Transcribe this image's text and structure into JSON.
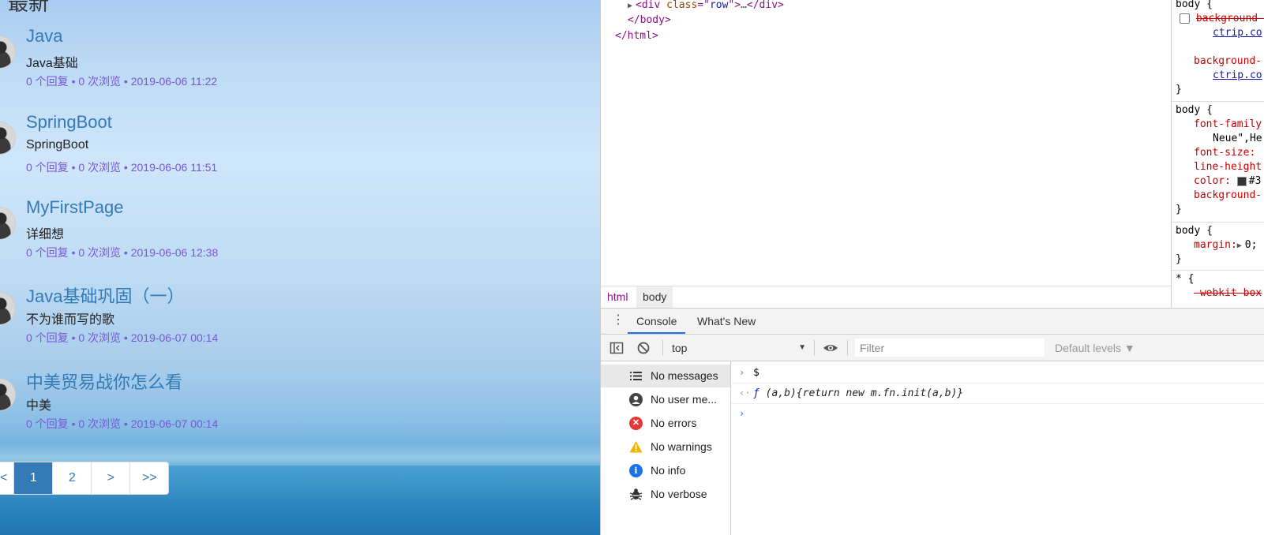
{
  "left": {
    "section_title": "最新",
    "topics": [
      {
        "title": "Java",
        "desc": "Java基础",
        "meta": "0 个回复 • 0 次浏览 • 2019-06-06 11:22"
      },
      {
        "title": "SpringBoot",
        "desc": "SpringBoot",
        "meta": "0 个回复 • 0 次浏览 • 2019-06-06 11:51"
      },
      {
        "title": "MyFirstPage",
        "desc": "详细想",
        "meta": "0 个回复 • 0 次浏览 • 2019-06-06 12:38"
      },
      {
        "title": "Java基础巩固（一）",
        "desc": "不为谁而写的歌",
        "meta": "0 个回复 • 0 次浏览 • 2019-06-07 00:14"
      },
      {
        "title": "中美贸易战你怎么看",
        "desc": "中美",
        "meta": "0 个回复 • 0 次浏览 • 2019-06-07 00:14"
      }
    ],
    "pagination": [
      "<",
      "1",
      "2",
      ">",
      ">>"
    ],
    "active_page": "1"
  },
  "devtools": {
    "elements": {
      "line1_tag_open": "<div ",
      "line1_attr": "class",
      "line1_eq": "=\"",
      "line1_val": "row",
      "line1_close": "\">",
      "line1_ellipsis": "…",
      "line1_end": "</div>",
      "line2": "</body>",
      "line3": "</html>"
    },
    "breadcrumbs": [
      "html",
      "body"
    ],
    "styles": {
      "rule1_selector": "body {",
      "rule1_prop1": "background-",
      "rule1_link1": "ctrip.co",
      "rule1_prop2": "background-",
      "rule1_link2": "ctrip.co",
      "rule2_selector": "body {",
      "rule2_props": [
        "font-family",
        "Neue\",He",
        "font-size:",
        "line-height",
        "color: ",
        "#3",
        "background-"
      ],
      "rule3_selector": "body {",
      "rule3_prop": "margin:",
      "rule3_value": "0;",
      "rule4_selector": "* {",
      "rule4_prop": "-webkit-box",
      "close_brace": "}"
    },
    "drawer_tabs": [
      "Console",
      "What's New"
    ],
    "toolbar": {
      "context": "top",
      "filter_placeholder": "Filter",
      "levels": "Default levels ▼"
    },
    "sidebar": [
      {
        "label": "No messages",
        "icon": "list-icon"
      },
      {
        "label": "No user me...",
        "icon": "user-icon"
      },
      {
        "label": "No errors",
        "icon": "error-icon"
      },
      {
        "label": "No warnings",
        "icon": "warning-icon"
      },
      {
        "label": "No info",
        "icon": "info-icon"
      },
      {
        "label": "No verbose",
        "icon": "bug-icon"
      }
    ],
    "console": {
      "input1": "$",
      "output_f": "ƒ",
      "output1": " (a,b){return new m.fn.init(a,b)}"
    },
    "colors": {
      "link_blue": "#337ab7",
      "meta_purple": "#7a55d8",
      "error_red": "#e53935",
      "warning_yellow": "#f5b400",
      "info_blue": "#1a73e8"
    }
  }
}
